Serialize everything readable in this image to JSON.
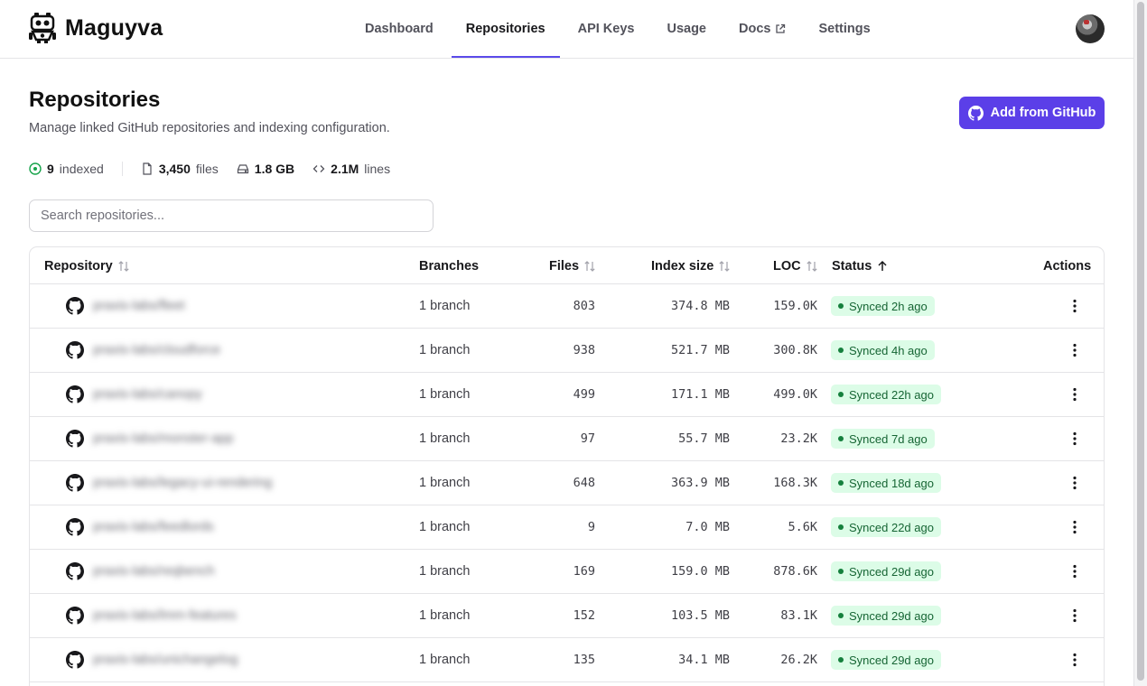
{
  "brand": {
    "name": "Maguyva"
  },
  "nav": {
    "items": [
      {
        "label": "Dashboard"
      },
      {
        "label": "Repositories"
      },
      {
        "label": "API Keys"
      },
      {
        "label": "Usage"
      },
      {
        "label": "Docs"
      },
      {
        "label": "Settings"
      }
    ],
    "active": "Repositories"
  },
  "header": {
    "title": "Repositories",
    "subtitle": "Manage linked GitHub repositories and indexing configuration.",
    "add_button": "Add from GitHub"
  },
  "stats": {
    "indexed_value": "9",
    "indexed_label": "indexed",
    "files_value": "3,450",
    "files_label": "files",
    "size_value": "1.8 GB",
    "lines_value": "2.1M",
    "lines_label": "lines"
  },
  "search": {
    "placeholder": "Search repositories..."
  },
  "table": {
    "columns": {
      "repository": "Repository",
      "branches": "Branches",
      "files": "Files",
      "index_size": "Index size",
      "loc": "LOC",
      "status": "Status",
      "actions": "Actions"
    },
    "rows": [
      {
        "name": "praxis-labs/fleet",
        "branches": "1 branch",
        "files": "803",
        "size": "374.8 MB",
        "loc": "159.0K",
        "status": "Synced 2h ago"
      },
      {
        "name": "praxis-labs/cloudforce",
        "branches": "1 branch",
        "files": "938",
        "size": "521.7 MB",
        "loc": "300.8K",
        "status": "Synced 4h ago"
      },
      {
        "name": "praxis-labs/canopy",
        "branches": "1 branch",
        "files": "499",
        "size": "171.1 MB",
        "loc": "499.0K",
        "status": "Synced 22h ago"
      },
      {
        "name": "praxis-labs/monster-app",
        "branches": "1 branch",
        "files": "97",
        "size": "55.7 MB",
        "loc": "23.2K",
        "status": "Synced 7d ago"
      },
      {
        "name": "praxis-labs/legacy-ui-rendering",
        "branches": "1 branch",
        "files": "648",
        "size": "363.9 MB",
        "loc": "168.3K",
        "status": "Synced 18d ago"
      },
      {
        "name": "praxis-labs/feedlords",
        "branches": "1 branch",
        "files": "9",
        "size": "7.0 MB",
        "loc": "5.6K",
        "status": "Synced 22d ago"
      },
      {
        "name": "praxis-labs/reqbench",
        "branches": "1 branch",
        "files": "169",
        "size": "159.0 MB",
        "loc": "878.6K",
        "status": "Synced 29d ago"
      },
      {
        "name": "praxis-labs/lmm-features",
        "branches": "1 branch",
        "files": "152",
        "size": "103.5 MB",
        "loc": "83.1K",
        "status": "Synced 29d ago"
      },
      {
        "name": "praxis-labs/unichangelog",
        "branches": "1 branch",
        "files": "135",
        "size": "34.1 MB",
        "loc": "26.2K",
        "status": "Synced 29d ago"
      }
    ]
  },
  "colors": {
    "accent": "#5b3fe8",
    "synced_bg": "#dcfce7",
    "synced_text": "#166534"
  }
}
